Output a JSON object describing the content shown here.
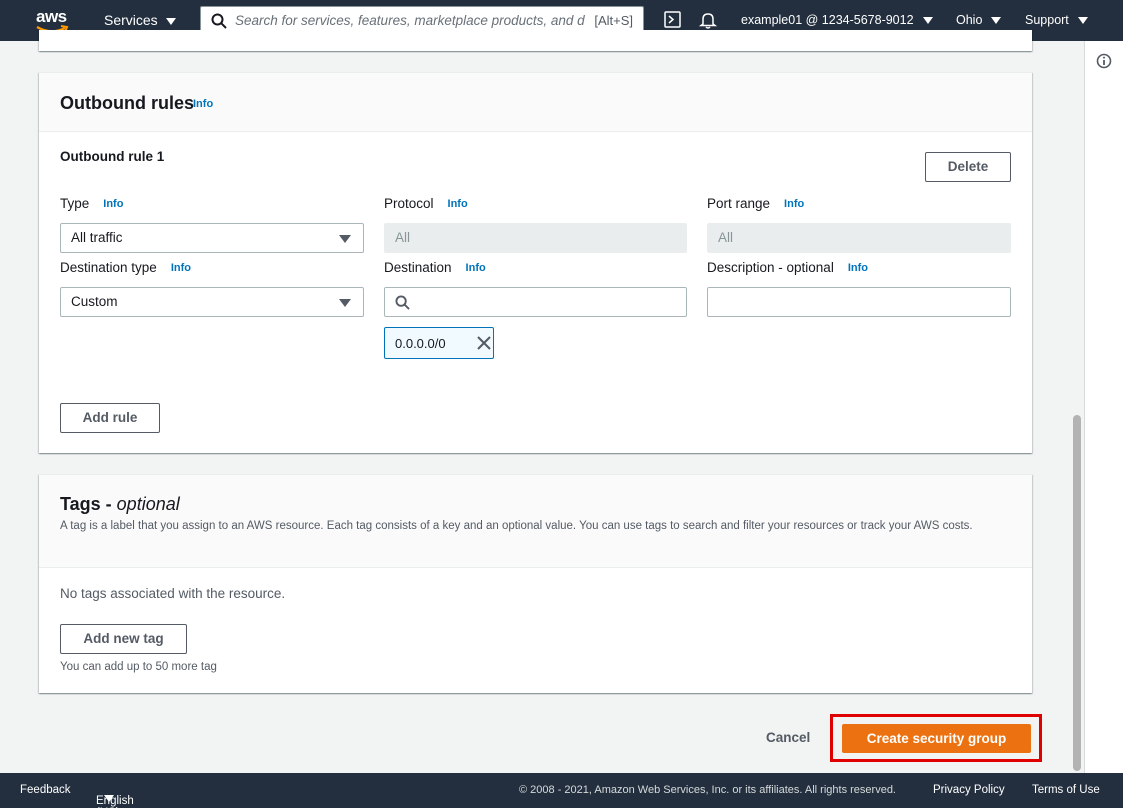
{
  "nav": {
    "logo_text": "aws",
    "services_label": "Services",
    "search_placeholder": "Search for services, features, marketplace products, and docs",
    "search_shortcut": "[Alt+S]",
    "account": "example01 @ 1234-5678-9012",
    "region": "Ohio",
    "support": "Support"
  },
  "outbound": {
    "title": "Outbound rules",
    "info": "Info",
    "rule_title": "Outbound rule 1",
    "delete_label": "Delete",
    "type_label": "Type",
    "type_value": "All traffic",
    "protocol_label": "Protocol",
    "protocol_value": "All",
    "port_range_label": "Port range",
    "port_range_value": "All",
    "destination_type_label": "Destination type",
    "destination_type_value": "Custom",
    "destination_label": "Destination",
    "destination_value": "",
    "destination_token": "0.0.0.0/0",
    "description_label": "Description - optional",
    "description_value": "",
    "add_rule_label": "Add rule"
  },
  "tags": {
    "title_prefix": "Tags - ",
    "title_suffix": "optional",
    "description": "A tag is a label that you assign to an AWS resource. Each tag consists of a key and an optional value. You can use tags to search and filter your resources or track your AWS costs.",
    "empty_text": "No tags associated with the resource.",
    "add_tag_label": "Add new tag",
    "limit_text": "You can add up to 50 more tag"
  },
  "actions": {
    "cancel_label": "Cancel",
    "create_label": "Create security group"
  },
  "footer": {
    "feedback": "Feedback",
    "language": "English (US)",
    "copyright": "© 2008 - 2021, Amazon Web Services, Inc. or its affiliates. All rights reserved.",
    "privacy": "Privacy Policy",
    "terms": "Terms of Use"
  },
  "colors": {
    "nav_bg": "#232f3e",
    "primary": "#ec7211",
    "link": "#0073bb",
    "highlight": "#e00000"
  }
}
